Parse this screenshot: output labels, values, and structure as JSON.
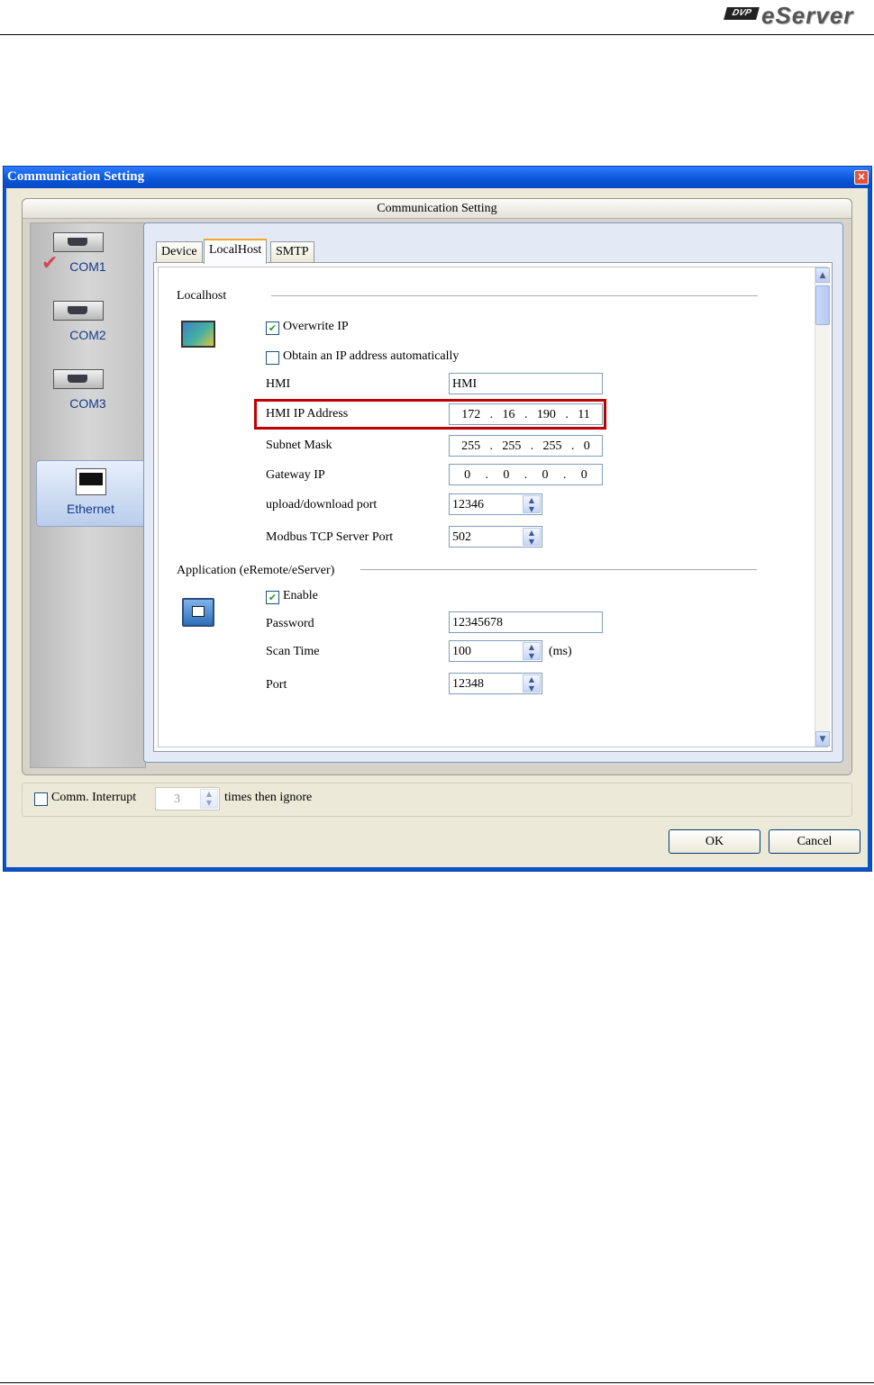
{
  "header": {
    "logo_badge": "DVP",
    "logo_text": "eServer"
  },
  "dialog": {
    "title": "Communication Setting",
    "panel_title": "Communication Setting",
    "nav": [
      {
        "label": "COM1"
      },
      {
        "label": "COM2"
      },
      {
        "label": "COM3"
      },
      {
        "label": "Ethernet"
      }
    ],
    "tabs": [
      "Device",
      "LocalHost",
      "SMTP"
    ],
    "localhost": {
      "section_title": "Localhost",
      "overwrite_ip_label": "Overwrite IP",
      "obtain_ip_label": "Obtain an IP address automatically",
      "hmi_label": "HMI",
      "hmi_value": "HMI",
      "hmi_ip_label": "HMI IP Address",
      "hmi_ip": [
        "172",
        "16",
        "190",
        "11"
      ],
      "subnet_label": "Subnet Mask",
      "subnet": [
        "255",
        "255",
        "255",
        "0"
      ],
      "gateway_label": "Gateway IP",
      "gateway": [
        "0",
        "0",
        "0",
        "0"
      ],
      "ip_sep": ".",
      "upload_port_label": "upload/download port",
      "upload_port": "12346",
      "modbus_label": "Modbus TCP  Server Port",
      "modbus_port": "502"
    },
    "application": {
      "section_title": "Application (eRemote/eServer)",
      "enable_label": "Enable",
      "password_label": "Password",
      "password": "12345678",
      "scan_time_label": "Scan Time",
      "scan_time": "100",
      "scan_unit": "(ms)",
      "port_label": "Port",
      "port": "12348"
    },
    "bottom": {
      "comm_interrupt_label": "Comm. Interrupt",
      "times_value": "3",
      "times_label": "times then ignore"
    },
    "buttons": {
      "ok": "OK",
      "cancel": "Cancel"
    }
  }
}
